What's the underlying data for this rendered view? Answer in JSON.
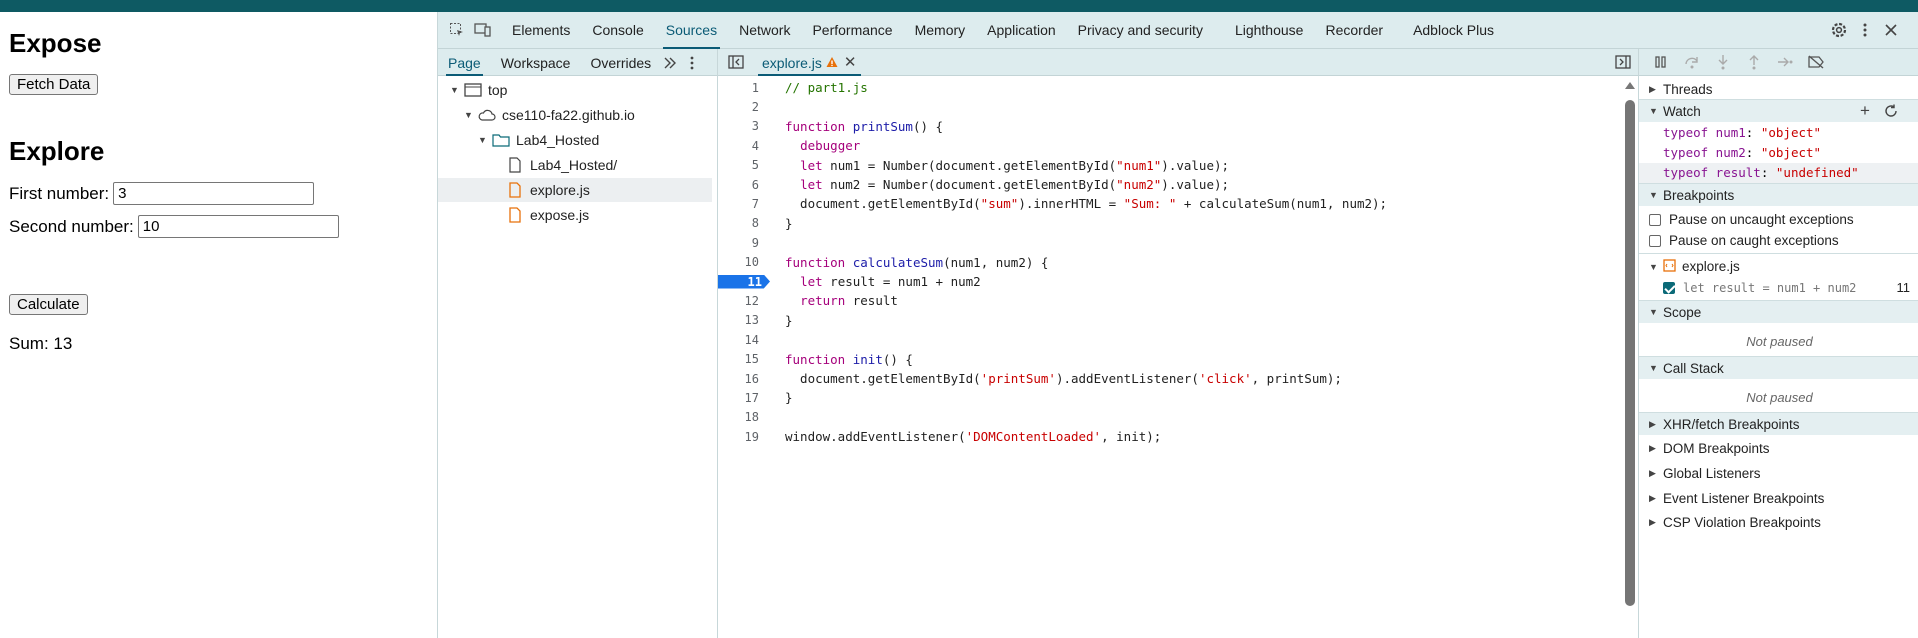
{
  "page": {
    "expose_heading": "Expose",
    "fetch_button": "Fetch Data",
    "explore_heading": "Explore",
    "first_label": "First number:",
    "first_value": "3",
    "second_label": "Second number:",
    "second_value": "10",
    "calculate_button": "Calculate",
    "sum_text": "Sum: 13"
  },
  "devtools": {
    "tabs": [
      "Elements",
      "Console",
      "Sources",
      "Network",
      "Performance",
      "Memory",
      "Application",
      "Privacy and security",
      "Lighthouse",
      "Recorder",
      "Adblock Plus"
    ],
    "active_tab": "Sources",
    "navigator_tabs": [
      "Page",
      "Workspace",
      "Overrides"
    ],
    "tree": {
      "top": "top",
      "domain": "cse110-fa22.github.io",
      "folder": "Lab4_Hosted",
      "index": "Lab4_Hosted/",
      "file1": "explore.js",
      "file2": "expose.js"
    },
    "open_file": "explore.js",
    "breakpoint_line": 11,
    "sidebar": {
      "threads": "Threads",
      "watch": "Watch",
      "watch_items": [
        {
          "expr": "typeof num1",
          "value": "\"object\""
        },
        {
          "expr": "typeof num2",
          "value": "\"object\""
        },
        {
          "expr": "typeof result",
          "value": "\"undefined\""
        }
      ],
      "breakpoints": "Breakpoints",
      "pause_uncaught": "Pause on uncaught exceptions",
      "pause_caught": "Pause on caught exceptions",
      "bp_file": "explore.js",
      "bp_code": "let result = num1 + num2",
      "bp_line": "11",
      "scope": "Scope",
      "not_paused_1": "Not paused",
      "call_stack": "Call Stack",
      "not_paused_2": "Not paused",
      "xhr": "XHR/fetch Breakpoints",
      "dom": "DOM Breakpoints",
      "global": "Global Listeners",
      "event": "Event Listener Breakpoints",
      "csp": "CSP Violation Breakpoints"
    }
  },
  "code_lines": [
    "// part1.js",
    "",
    "function printSum() {",
    "  debugger",
    "  let num1 = Number(document.getElementById(\"num1\").value);",
    "  let num2 = Number(document.getElementById(\"num2\").value);",
    "  document.getElementById(\"sum\").innerHTML = \"Sum: \" + calculateSum(num1, num2);",
    "}",
    "",
    "function calculateSum(num1, num2) {",
    "  let result = num1 + num2",
    "  return result",
    "}",
    "",
    "function init() {",
    "  document.getElementById('printSum').addEventListener('click', printSum);",
    "}",
    "",
    "window.addEventListener('DOMContentLoaded', init);"
  ],
  "colors": {
    "accent": "#0b5b76",
    "breakpoint": "#1a73e8",
    "keyword": "#a5007b",
    "string": "#c80000",
    "comment": "#247400"
  }
}
